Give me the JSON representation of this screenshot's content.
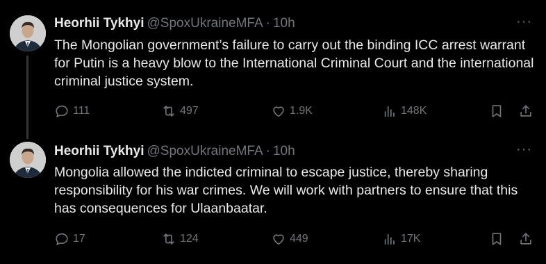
{
  "tweets": [
    {
      "author_name": "Heorhii Tykhyi",
      "handle": "@SpoxUkraineMFA",
      "separator": "·",
      "time": "10h",
      "more": "···",
      "text": "The Mongolian government’s failure to carry out the binding ICC arrest warrant for Putin is a heavy blow to the International Criminal Court and the international criminal justice system.",
      "replies": "111",
      "reposts": "497",
      "likes": "1.9K",
      "views": "148K"
    },
    {
      "author_name": "Heorhii Tykhyi",
      "handle": "@SpoxUkraineMFA",
      "separator": "·",
      "time": "10h",
      "more": "···",
      "text": "Mongolia allowed the indicted criminal to escape justice, thereby sharing responsibility for his war crimes. We will work with partners to ensure that this has consequences for Ulaanbaatar.",
      "replies": "17",
      "reposts": "124",
      "likes": "449",
      "views": "17K"
    }
  ],
  "icons": {
    "reply": "reply-icon",
    "repost": "repost-icon",
    "like": "like-icon",
    "views": "views-icon",
    "bookmark": "bookmark-icon",
    "share": "share-icon"
  },
  "colors": {
    "background": "#000000",
    "text": "#e7e9ea",
    "secondary": "#71767b",
    "thread_line": "#333639"
  }
}
